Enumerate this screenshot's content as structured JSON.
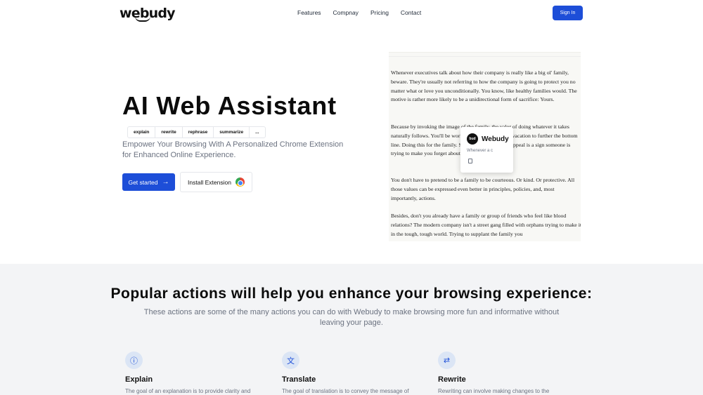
{
  "nav": {
    "logo": "webudy",
    "links": [
      "Features",
      "Compnay",
      "Pricing",
      "Contact"
    ],
    "signin_label": "Sign In"
  },
  "hero": {
    "title": "AI Web Assistant",
    "actions": [
      "explain",
      "rewrite",
      "rephrase",
      "summarize",
      "..."
    ],
    "subtitle": "Empower Your Browsing With A Personalized Chrome Extension for Enhanced Online Experience.",
    "get_started_label": "Get started",
    "install_label": "Install Extension"
  },
  "article": {
    "p1": "Whenever executives talk about how their company is really like a big ol' family, beware. They're usually not referring to how the company is going to protect you no matter what or love you unconditionally. You know, like healthy families would. The motive is rather more likely to be a unidirectional form of sacrifice: Yours.",
    "p2": "Because by invoking the image of the family, the valor of doing whatever it takes naturally follows. You'll be working nights or skipping vacation to further the bottom line. Doing this for the family. Such a blunt emotional appeal is a sign someone is trying to make you forget about your rational interests.",
    "p3": "You don't have to pretend to be a family to be courteous. Or kind. Or protective. All those values can be expressed even better in principles, policies, and, most importantly, actions.",
    "p4": "Besides, don't you already have a family or group of friends who feel like blood relations? The modern company isn't a street gang filled with orphans trying to make it in the tough, tough world. Trying to supplant the family you"
  },
  "popup": {
    "title": "Webudy",
    "text": "Whenever a c",
    "logo_text": "bud"
  },
  "section2": {
    "title": "Popular actions will help you enhance your browsing experience:",
    "subtitle": "These actions are some of the many actions you can do with Webudy to make browsing more fun and informative without leaving your page.",
    "features": [
      {
        "icon": "info-icon",
        "title": "Explain",
        "desc": "The goal of an explanation is to provide clarity and"
      },
      {
        "icon": "translate-icon",
        "title": "Translate",
        "desc": "The goal of translation is to convey the message of"
      },
      {
        "icon": "swap-icon",
        "title": "Rewrite",
        "desc": "Rewriting can involve making changes to the"
      }
    ]
  },
  "colors": {
    "accent": "#1d4ed8",
    "section_bg": "#f3f4f6",
    "icon_bg": "#dbe5f5"
  }
}
